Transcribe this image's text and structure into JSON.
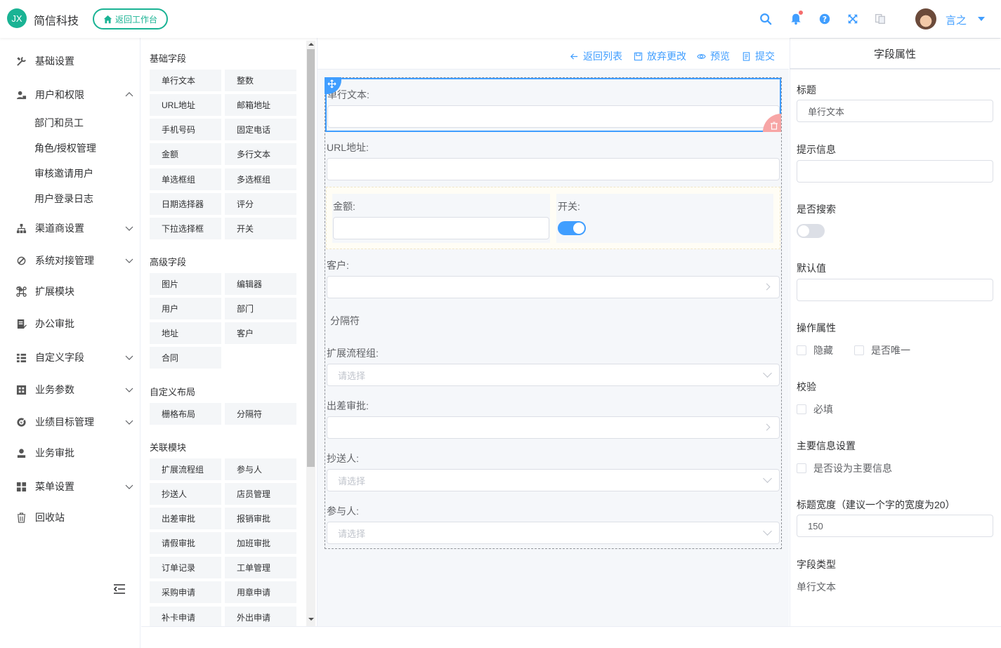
{
  "header": {
    "logo_text": "JX",
    "brand": "简信科技",
    "back_label": "返回工作台",
    "username": "言之",
    "icons": [
      "search-icon",
      "bell-icon",
      "help-icon",
      "fullscreen-icon",
      "translate-icon"
    ],
    "accent": "#409eff",
    "brand_color": "#1ab394"
  },
  "sidebar": {
    "items": [
      {
        "label": "基础设置",
        "icon": "tools-icon"
      },
      {
        "label": "用户和权限",
        "icon": "user-lock-icon",
        "expanded": true
      },
      {
        "label": "渠道商设置",
        "icon": "hierarchy-icon"
      },
      {
        "label": "系统对接管理",
        "icon": "plug-icon"
      },
      {
        "label": "扩展模块",
        "icon": "command-icon"
      },
      {
        "label": "办公审批",
        "icon": "doc-edit-icon"
      },
      {
        "label": "自定义字段",
        "icon": "list-icon"
      },
      {
        "label": "业务参数",
        "icon": "grid-icon"
      },
      {
        "label": "业绩目标管理",
        "icon": "target-icon"
      },
      {
        "label": "业务审批",
        "icon": "user-check-icon"
      },
      {
        "label": "菜单设置",
        "icon": "menu-grid-icon"
      },
      {
        "label": "回收站",
        "icon": "trash-icon"
      }
    ],
    "sub_items": [
      "部门和员工",
      "角色/授权管理",
      "审核邀请用户",
      "用户登录日志"
    ]
  },
  "components": {
    "groups": [
      {
        "title": "基础字段",
        "items": [
          "单行文本",
          "整数",
          "URL地址",
          "邮箱地址",
          "手机号码",
          "固定电话",
          "金额",
          "多行文本",
          "单选框组",
          "多选框组",
          "日期选择器",
          "评分",
          "下拉选择框",
          "开关"
        ]
      },
      {
        "title": "高级字段",
        "items": [
          "图片",
          "编辑器",
          "用户",
          "部门",
          "地址",
          "客户",
          "合同"
        ]
      },
      {
        "title": "自定义布局",
        "items": [
          "栅格布局",
          "分隔符"
        ]
      },
      {
        "title": "关联模块",
        "items": [
          "扩展流程组",
          "参与人",
          "抄送人",
          "店员管理",
          "出差审批",
          "报销审批",
          "请假审批",
          "加班审批",
          "订单记录",
          "工单管理",
          "采购申请",
          "用章申请",
          "补卡申请",
          "外出申请"
        ]
      }
    ]
  },
  "toolbar": {
    "back_list": "返回列表",
    "discard": "放弃更改",
    "preview": "预览",
    "submit": "提交"
  },
  "form": {
    "fields": {
      "single_text": "单行文本:",
      "url": "URL地址:",
      "amount": "金额:",
      "switch": "开关:",
      "customer": "客户:",
      "divider": "分隔符",
      "ext_flow": "扩展流程组:",
      "trip": "出差审批:",
      "cc": "抄送人:",
      "participant": "参与人:"
    },
    "select_placeholder": "请选择",
    "switch_on": true
  },
  "properties": {
    "header": "字段属性",
    "title_label": "标题",
    "title_value": "单行文本",
    "hint_label": "提示信息",
    "hint_value": "",
    "search_label": "是否搜索",
    "search_on": false,
    "default_label": "默认值",
    "default_value": "",
    "ops_label": "操作属性",
    "hide_label": "隐藏",
    "unique_label": "是否唯一",
    "validate_label": "校验",
    "required_label": "必填",
    "main_label": "主要信息设置",
    "main_cb_label": "是否设为主要信息",
    "width_label": "标题宽度（建议一个字的宽度为20）",
    "width_value": "150",
    "type_label": "字段类型",
    "type_value": "单行文本"
  }
}
